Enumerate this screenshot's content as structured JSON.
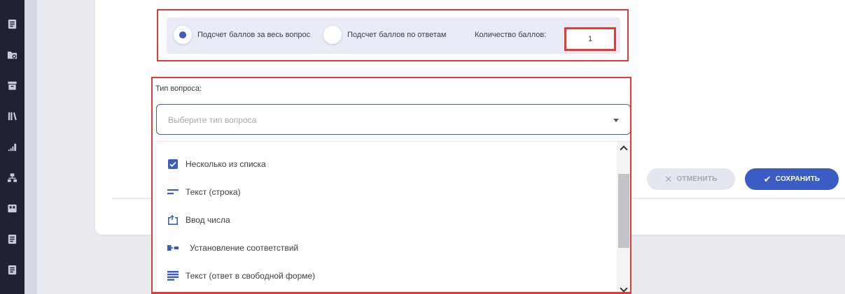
{
  "scoring": {
    "whole_question_label": "Подсчет баллов за весь вопрос",
    "by_answers_label": "Подсчет баллов по ответам",
    "points_label": "Количество баллов:",
    "points_value": "1",
    "selected": "whole_question"
  },
  "question_type": {
    "label": "Тип вопроса:",
    "placeholder": "Выберите тип вопроса",
    "options": [
      {
        "label": "Несколько из списка",
        "icon": "checkbox-icon"
      },
      {
        "label": "Текст (строка)",
        "icon": "text-line-icon"
      },
      {
        "label": "Ввод числа",
        "icon": "number-input-icon"
      },
      {
        "label": "Установление соответствий",
        "icon": "matching-icon"
      },
      {
        "label": "Текст (ответ в свободной форме)",
        "icon": "free-text-icon"
      }
    ]
  },
  "actions": {
    "cancel_label": "Отменить",
    "save_label": "Сохранить"
  },
  "sidebar": {
    "icons": [
      "document-icon",
      "folder-settings-icon",
      "archive-icon",
      "library-icon",
      "chart-icon",
      "hierarchy-icon",
      "board-icon",
      "document-icon",
      "document-icon"
    ]
  },
  "colors": {
    "accent": "#3b5cc4",
    "highlight_border": "#e53935",
    "sidebar_bg": "#1f2230"
  }
}
